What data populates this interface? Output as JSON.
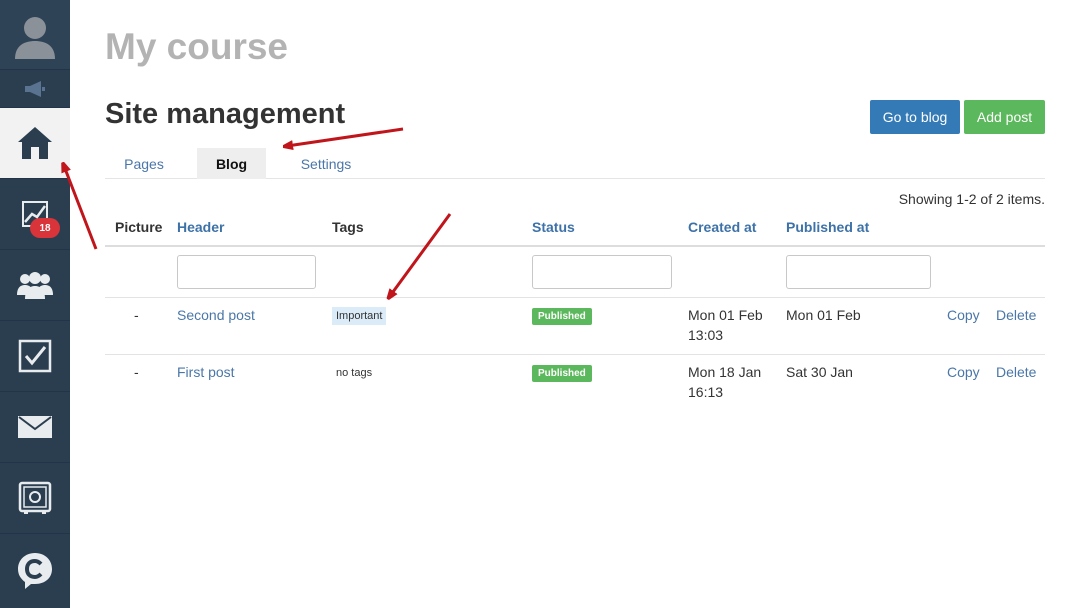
{
  "sidebar": {
    "icons": [
      "user-avatar-icon",
      "speaker-icon",
      "home-icon",
      "stats-icon",
      "users-icon",
      "checkbox-icon",
      "mail-icon",
      "safe-icon",
      "chat-logo-icon"
    ],
    "stats_badge": "18"
  },
  "page": {
    "course_title": "My course",
    "section_title": "Site management"
  },
  "buttons": {
    "go_to_blog": "Go to blog",
    "add_post": "Add post"
  },
  "tabs": [
    {
      "label": "Pages",
      "active": false
    },
    {
      "label": "Blog",
      "active": true
    },
    {
      "label": "Settings",
      "active": false
    }
  ],
  "table": {
    "summary": "Showing 1-2 of 2 items.",
    "columns": [
      "Picture",
      "Header",
      "Tags",
      "Status",
      "Created at",
      "Published at"
    ],
    "rows": [
      {
        "picture": "-",
        "header": "Second post",
        "tags": "Important",
        "status": "Published",
        "created_date": "Mon 01 Feb",
        "created_time": "13:03",
        "published": "Mon 01 Feb",
        "copy": "Copy",
        "delete": "Delete"
      },
      {
        "picture": "-",
        "header": "First post",
        "tags": "no tags",
        "status": "Published",
        "created_date": "Mon 18 Jan",
        "created_time": "16:13",
        "published": "Sat 30 Jan",
        "copy": "Copy",
        "delete": "Delete"
      }
    ]
  },
  "colors": {
    "sidebar": "#2b3e50",
    "primary": "#337ab7",
    "success": "#5cb85c",
    "badge": "#d9343a",
    "annotation_arrow": "#c0151b"
  }
}
